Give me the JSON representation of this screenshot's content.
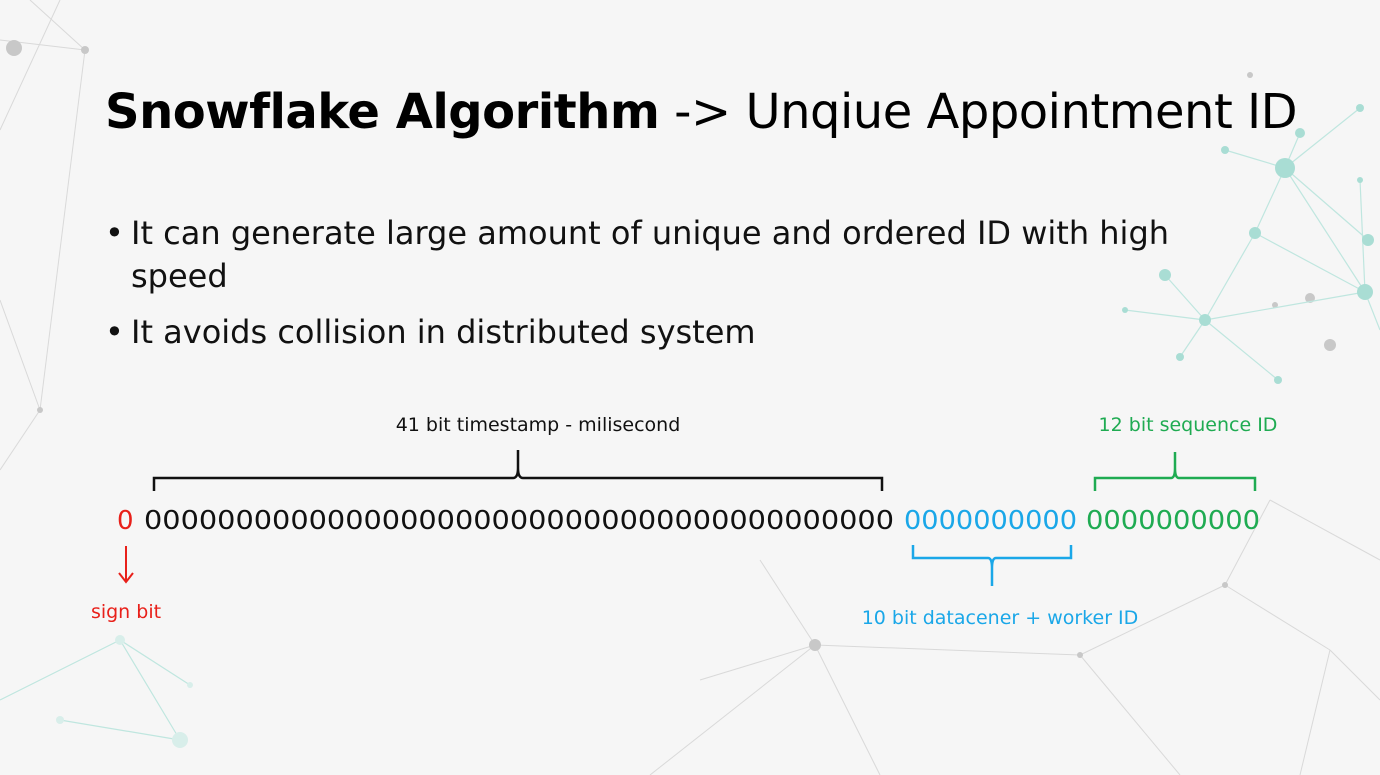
{
  "slide": {
    "title_bold": "Snowflake Algorithm",
    "title_rest": " -> Unqiue Appointment ID",
    "bullets": [
      "It can generate large amount of unique and ordered ID with high speed",
      "It avoids collision in distributed system"
    ]
  },
  "diagram": {
    "sign_bit_value": "0",
    "timestamp_bits": "00000000000000000000000000000000000000000",
    "worker_bits": "0000000000",
    "sequence_bits": "0000000000",
    "labels": {
      "timestamp": "41 bit timestamp - milisecond",
      "sequence": "12 bit sequence ID",
      "sign": "sign bit",
      "worker": "10 bit datacener + worker ID"
    },
    "colors": {
      "sign": "#e8201a",
      "worker": "#1aa7e8",
      "sequence": "#1fab52",
      "timestamp": "#111111"
    }
  }
}
